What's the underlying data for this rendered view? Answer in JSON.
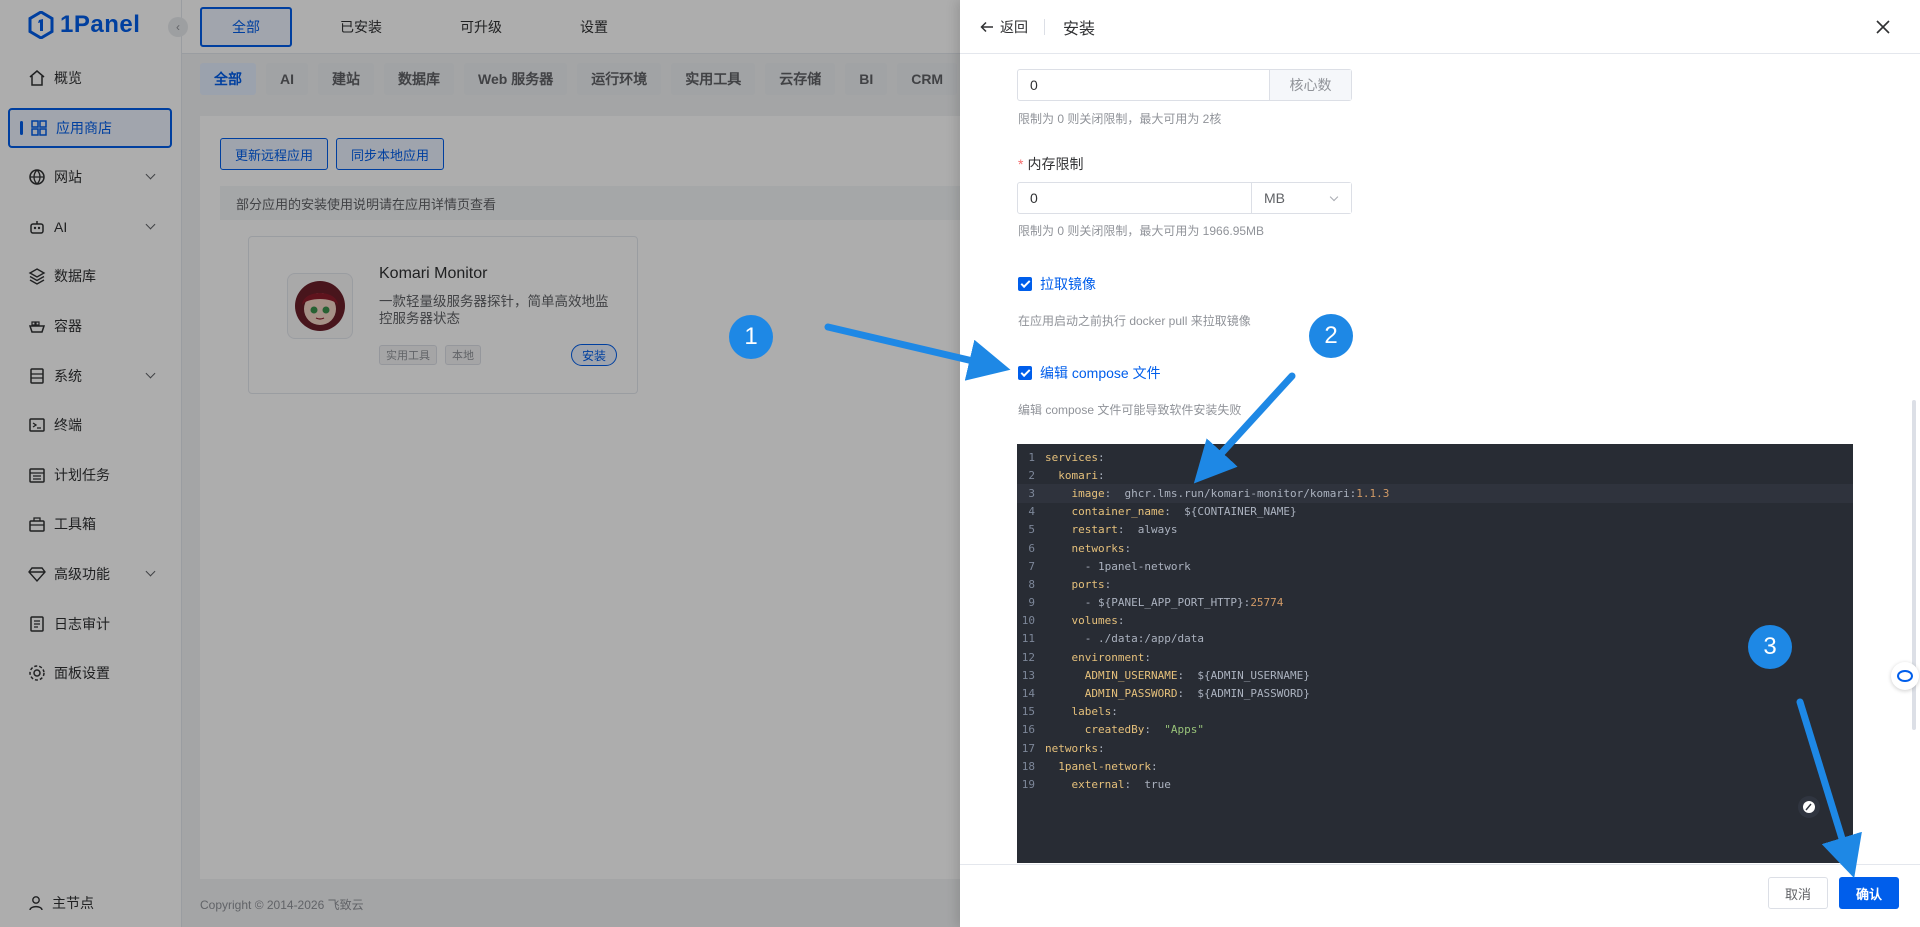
{
  "brand": {
    "logo_text": "1Panel"
  },
  "sidebar": {
    "items": [
      {
        "label": "概览",
        "icon": "home-icon"
      },
      {
        "label": "应用商店",
        "icon": "grid-icon",
        "active": true
      },
      {
        "label": "网站",
        "icon": "globe-icon",
        "expand": true
      },
      {
        "label": "AI",
        "icon": "robot-icon",
        "expand": true
      },
      {
        "label": "数据库",
        "icon": "layers-icon"
      },
      {
        "label": "容器",
        "icon": "container-icon"
      },
      {
        "label": "系统",
        "icon": "server-icon",
        "expand": true
      },
      {
        "label": "终端",
        "icon": "terminal-icon"
      },
      {
        "label": "计划任务",
        "icon": "calendar-icon"
      },
      {
        "label": "工具箱",
        "icon": "toolbox-icon"
      },
      {
        "label": "高级功能",
        "icon": "diamond-icon",
        "expand": true
      },
      {
        "label": "日志审计",
        "icon": "log-icon"
      },
      {
        "label": "面板设置",
        "icon": "settings-icon"
      }
    ],
    "footer_label": "主节点"
  },
  "top_tabs": [
    "全部",
    "已安装",
    "可升级",
    "设置"
  ],
  "categories": [
    "全部",
    "AI",
    "建站",
    "数据库",
    "Web 服务器",
    "运行环境",
    "实用工具",
    "云存储",
    "BI",
    "CRM"
  ],
  "content": {
    "update_remote_btn": "更新远程应用",
    "sync_local_btn": "同步本地应用",
    "notice": "部分应用的安装使用说明请在应用详情页查看",
    "app": {
      "name": "Komari Monitor",
      "description": "一款轻量级服务器探针，简单高效地监控服务器状态",
      "tags": [
        "实用工具",
        "本地"
      ],
      "install_label": "安装"
    },
    "copyright": "Copyright © 2014-2026 飞致云"
  },
  "drawer": {
    "back_label": "返回",
    "title": "安装",
    "cpu_value": "0",
    "cpu_suffix": "核心数",
    "cpu_hint": "限制为 0 则关闭限制，最大可用为 2核",
    "memory_label": "内存限制",
    "memory_value": "0",
    "memory_unit": "MB",
    "memory_hint": "限制为 0 则关闭限制，最大可用为 1966.95MB",
    "pull_image_label": "拉取镜像",
    "pull_image_hint": "在应用启动之前执行 docker pull 来拉取镜像",
    "edit_compose_label": "编辑 compose 文件",
    "edit_compose_hint": "编辑 compose 文件可能导致软件安装失败",
    "cancel_label": "取消",
    "confirm_label": "确认"
  },
  "compose_lines": [
    [
      [
        "k",
        "services"
      ],
      [
        "p",
        ":"
      ]
    ],
    [
      [
        "p",
        "  "
      ],
      [
        "k",
        "komari"
      ],
      [
        "p",
        ":"
      ]
    ],
    [
      [
        "p",
        "    "
      ],
      [
        "k",
        "image"
      ],
      [
        "p",
        ":  ghcr.lms.run/komari-monitor/komari:"
      ],
      [
        "n",
        "1.1.3"
      ]
    ],
    [
      [
        "p",
        "    "
      ],
      [
        "k",
        "container_name"
      ],
      [
        "p",
        ":  ${CONTAINER_NAME}"
      ]
    ],
    [
      [
        "p",
        "    "
      ],
      [
        "k",
        "restart"
      ],
      [
        "p",
        ":  always"
      ]
    ],
    [
      [
        "p",
        "    "
      ],
      [
        "k",
        "networks"
      ],
      [
        "p",
        ":"
      ]
    ],
    [
      [
        "p",
        "      - 1panel-network"
      ]
    ],
    [
      [
        "p",
        "    "
      ],
      [
        "k",
        "ports"
      ],
      [
        "p",
        ":"
      ]
    ],
    [
      [
        "p",
        "      - ${PANEL_APP_PORT_HTTP}:"
      ],
      [
        "n",
        "25774"
      ]
    ],
    [
      [
        "p",
        "    "
      ],
      [
        "k",
        "volumes"
      ],
      [
        "p",
        ":"
      ]
    ],
    [
      [
        "p",
        "      - ./data:/app/data"
      ]
    ],
    [
      [
        "p",
        "    "
      ],
      [
        "k",
        "environment"
      ],
      [
        "p",
        ":"
      ]
    ],
    [
      [
        "p",
        "      "
      ],
      [
        "k",
        "ADMIN_USERNAME"
      ],
      [
        "p",
        ":  ${ADMIN_USERNAME}"
      ]
    ],
    [
      [
        "p",
        "      "
      ],
      [
        "k",
        "ADMIN_PASSWORD"
      ],
      [
        "p",
        ":  ${ADMIN_PASSWORD}"
      ]
    ],
    [
      [
        "p",
        "    "
      ],
      [
        "k",
        "labels"
      ],
      [
        "p",
        ":"
      ]
    ],
    [
      [
        "p",
        "      "
      ],
      [
        "k",
        "createdBy"
      ],
      [
        "p",
        ":  "
      ],
      [
        "s",
        "\"Apps\""
      ]
    ],
    [
      [
        "k",
        "networks"
      ],
      [
        "p",
        ":"
      ]
    ],
    [
      [
        "p",
        "  "
      ],
      [
        "k",
        "1panel-network"
      ],
      [
        "p",
        ":"
      ]
    ],
    [
      [
        "p",
        "    "
      ],
      [
        "k",
        "external"
      ],
      [
        "p",
        ":  true"
      ]
    ]
  ],
  "annotations": [
    "1",
    "2",
    "3"
  ],
  "colors": {
    "accent": "#005eeb",
    "annotation": "#1e88e5",
    "editor_bg": "#282c34"
  }
}
